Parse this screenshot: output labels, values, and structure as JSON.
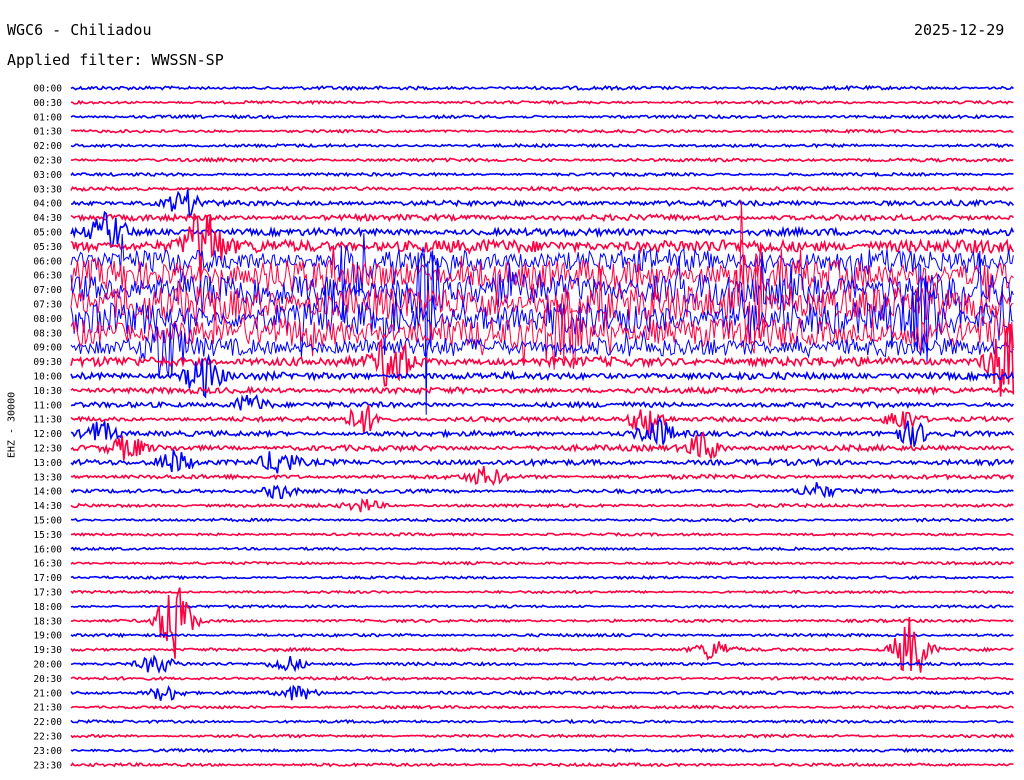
{
  "header": {
    "station": "WGC6 - Chiliadou",
    "date": "2025-12-29",
    "filter": "Applied filter: WWSSN-SP"
  },
  "ylabel": "EHZ - 30000",
  "colors": {
    "trace_a": "#0000ff",
    "trace_b": "#ff0040",
    "background": "#ffffff"
  },
  "chart_data": {
    "type": "line",
    "title": "WGC6 - Chiliadou",
    "subtitle": "Applied filter: WWSSN-SP",
    "ylabel": "EHZ - 30000",
    "grid": false,
    "rows": [
      "00:00",
      "00:30",
      "01:00",
      "01:30",
      "02:00",
      "02:30",
      "03:00",
      "03:30",
      "04:00",
      "04:30",
      "05:00",
      "05:30",
      "06:00",
      "06:30",
      "07:00",
      "07:30",
      "08:00",
      "08:30",
      "09:00",
      "09:30",
      "10:00",
      "10:30",
      "11:00",
      "11:30",
      "12:00",
      "12:30",
      "13:00",
      "13:30",
      "14:00",
      "14:30",
      "15:00",
      "15:30",
      "16:00",
      "16:30",
      "17:00",
      "17:30",
      "18:00",
      "18:30",
      "19:00",
      "19:30",
      "20:00",
      "20:30",
      "21:00",
      "21:30",
      "22:00",
      "22:30",
      "23:00",
      "23:30"
    ],
    "noise_level": [
      1.5,
      1.2,
      1.3,
      1.2,
      1.3,
      1.4,
      1.3,
      1.6,
      2.2,
      2.5,
      3.0,
      5.5,
      10,
      13,
      15,
      15,
      14,
      13,
      8,
      4,
      3,
      2.5,
      2.2,
      2.0,
      2.2,
      2.4,
      2.4,
      1.8,
      1.6,
      1.4,
      1.2,
      1.1,
      1.1,
      1.1,
      1.1,
      1.1,
      1.1,
      1.2,
      1.2,
      1.3,
      1.3,
      1.3,
      1.3,
      1.2,
      1.2,
      1.2,
      1.2,
      1.3
    ],
    "events": [
      {
        "row": "04:00",
        "t": 0.12,
        "amp": 12
      },
      {
        "row": "05:00",
        "t": 0.04,
        "amp": 18
      },
      {
        "row": "05:30",
        "t": 0.14,
        "amp": 40
      },
      {
        "row": "06:00",
        "t": 0.3,
        "amp": 30
      },
      {
        "row": "07:00",
        "t": 0.38,
        "amp": 45
      },
      {
        "row": "07:30",
        "t": 0.72,
        "amp": 50
      },
      {
        "row": "08:00",
        "t": 0.9,
        "amp": 48
      },
      {
        "row": "08:30",
        "t": 0.52,
        "amp": 42
      },
      {
        "row": "09:00",
        "t": 0.1,
        "amp": 30
      },
      {
        "row": "09:30",
        "t": 0.34,
        "amp": 28
      },
      {
        "row": "09:30",
        "t": 0.99,
        "amp": 40
      },
      {
        "row": "10:00",
        "t": 0.14,
        "amp": 20
      },
      {
        "row": "11:00",
        "t": 0.19,
        "amp": 10
      },
      {
        "row": "11:30",
        "t": 0.31,
        "amp": 14
      },
      {
        "row": "11:30",
        "t": 0.61,
        "amp": 16
      },
      {
        "row": "11:30",
        "t": 0.88,
        "amp": 12
      },
      {
        "row": "12:00",
        "t": 0.03,
        "amp": 12
      },
      {
        "row": "12:00",
        "t": 0.62,
        "amp": 14
      },
      {
        "row": "12:00",
        "t": 0.89,
        "amp": 11
      },
      {
        "row": "12:30",
        "t": 0.06,
        "amp": 11
      },
      {
        "row": "12:30",
        "t": 0.67,
        "amp": 14
      },
      {
        "row": "13:00",
        "t": 0.11,
        "amp": 12
      },
      {
        "row": "13:00",
        "t": 0.22,
        "amp": 12
      },
      {
        "row": "13:30",
        "t": 0.44,
        "amp": 9
      },
      {
        "row": "14:00",
        "t": 0.22,
        "amp": 7
      },
      {
        "row": "14:00",
        "t": 0.79,
        "amp": 8
      },
      {
        "row": "14:30",
        "t": 0.31,
        "amp": 6
      },
      {
        "row": "18:30",
        "t": 0.11,
        "amp": 40
      },
      {
        "row": "19:30",
        "t": 0.68,
        "amp": 10
      },
      {
        "row": "19:30",
        "t": 0.89,
        "amp": 32
      },
      {
        "row": "20:00",
        "t": 0.09,
        "amp": 9
      },
      {
        "row": "20:00",
        "t": 0.23,
        "amp": 8
      },
      {
        "row": "21:00",
        "t": 0.1,
        "amp": 8
      },
      {
        "row": "21:00",
        "t": 0.24,
        "amp": 7
      }
    ]
  }
}
